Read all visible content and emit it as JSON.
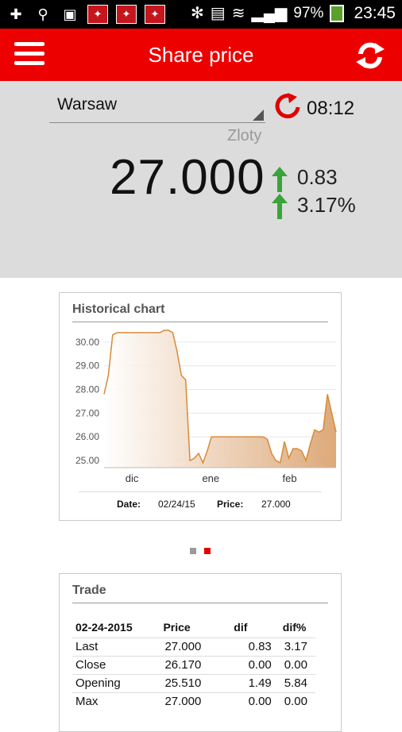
{
  "status_bar": {
    "battery": "97%",
    "time": "23:45"
  },
  "toolbar": {
    "title": "Share price"
  },
  "quote": {
    "market": "Warsaw",
    "update_time": "08:12",
    "currency": "Zloty",
    "price": "27.000",
    "change_abs": "0.83",
    "change_pct": "3.17%",
    "trend_color": "#3aa33a"
  },
  "historical_card": {
    "title": "Historical chart",
    "date_label": "Date:",
    "date_value": "02/24/15",
    "price_label": "Price:",
    "price_value": "27.000"
  },
  "chart_data": {
    "type": "area",
    "y_tick_labels": [
      "30.00",
      "29.00",
      "28.00",
      "27.00",
      "26.00",
      "25.00"
    ],
    "x_tick_labels": [
      "dic",
      "ene",
      "feb"
    ],
    "ylim": [
      24.7,
      30.6
    ],
    "series": [
      {
        "values": [
          27.8,
          28.6,
          30.3,
          30.4,
          30.4,
          30.4,
          30.4,
          30.4,
          30.4,
          30.4,
          30.4,
          30.4,
          30.4,
          30.4,
          30.5,
          30.5,
          30.4,
          29.6,
          28.6,
          28.4,
          25.0,
          25.1,
          25.3,
          24.9,
          25.4,
          26.0,
          26.0,
          26.0,
          26.0,
          26.0,
          26.0,
          26.0,
          26.0,
          26.0,
          26.0,
          26.0,
          26.0,
          26.0,
          25.9,
          25.3,
          25.0,
          24.9,
          25.8,
          25.1,
          25.5,
          25.5,
          25.4,
          25.0,
          25.7,
          26.3,
          26.2,
          26.3,
          27.8,
          27.0,
          26.2
        ],
        "color": "#d88a38"
      }
    ],
    "grid": true
  },
  "pager": {
    "pages": 2,
    "active": 2
  },
  "trade_card": {
    "title": "Trade",
    "columns": [
      "02-24-2015",
      "Price",
      "dif",
      "dif%"
    ],
    "rows": [
      [
        "Last",
        "27.000",
        "0.83",
        "3.17"
      ],
      [
        "Close",
        "26.170",
        "0.00",
        "0.00"
      ],
      [
        "Opening",
        "25.510",
        "1.49",
        "5.84"
      ],
      [
        "Max",
        "27.000",
        "0.00",
        "0.00"
      ]
    ]
  },
  "colors": {
    "brand_red": "#ec0000",
    "panel_gray": "#dcdcdc"
  }
}
